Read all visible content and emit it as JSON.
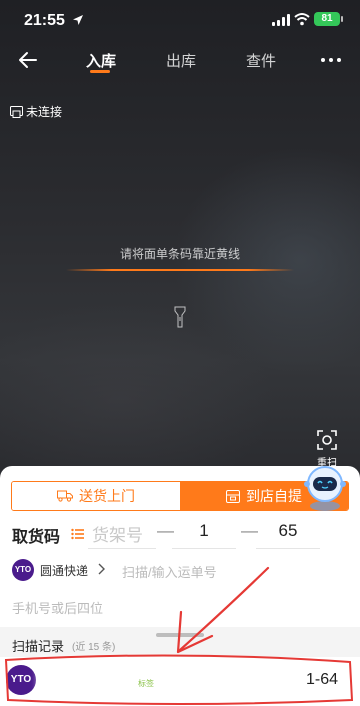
{
  "status_bar": {
    "time": "21:55",
    "battery": "81"
  },
  "nav": {
    "tabs": [
      {
        "label": "入库",
        "active": true
      },
      {
        "label": "出库",
        "active": false
      },
      {
        "label": "查件",
        "active": false
      }
    ]
  },
  "scanner": {
    "connection_status": "未连接",
    "hint": "请将面单条码靠近黄线",
    "rescan_label": "重扫",
    "accent_color": "#ff7a1a"
  },
  "mode_toggle": {
    "options": [
      {
        "label": "送货上门",
        "selected": false
      },
      {
        "label": "到店自提",
        "selected": true
      }
    ]
  },
  "pickup_code": {
    "label": "取货码",
    "shelf_placeholder": "货架号",
    "dash": "—",
    "value_1": "1",
    "value_2": "65"
  },
  "courier": {
    "logo_text": "YTO",
    "name": "圆通快递",
    "tracking_placeholder": "扫描/输入运单号"
  },
  "phone": {
    "placeholder": "手机号或后四位"
  },
  "records": {
    "title": "扫描记录",
    "count": "(近 15 条)",
    "items": [
      {
        "logo_text": "YTO",
        "code": "1-64",
        "badge": "标签"
      }
    ]
  }
}
